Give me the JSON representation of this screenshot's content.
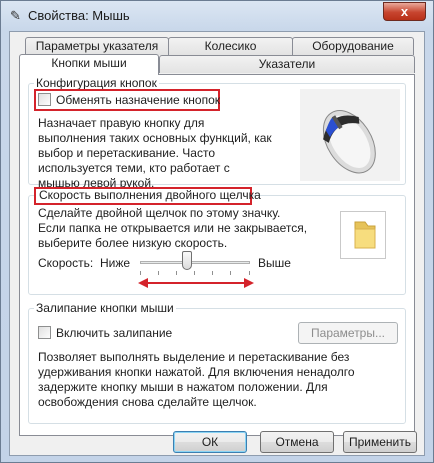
{
  "window": {
    "title": "Свойства: Мышь",
    "close": "x"
  },
  "tabs_back": [
    "Параметры указателя",
    "Колесико",
    "Оборудование"
  ],
  "tabs_front": [
    "Кнопки мыши",
    "Указатели"
  ],
  "buttons_config": {
    "title": "Конфигурация кнопок",
    "checkbox_label": "Обменять назначение кнопок",
    "checked": false,
    "description": "Назначает правую кнопку для выполнения таких основных функций, как выбор и перетаскивание. Часто используется теми, кто работает с мышью левой рукой."
  },
  "double_click": {
    "title": "Скорость выполнения двойного щелчка",
    "description": "Сделайте двойной щелчок по этому значку. Если папка не открывается или не закрывается, выберите более низкую скорость.",
    "speed_label": "Скорость:",
    "slow_label": "Ниже",
    "fast_label": "Выше",
    "slider_position": 0.42
  },
  "click_lock": {
    "title": "Залипание кнопки мыши",
    "checkbox_label": "Включить залипание",
    "checked": false,
    "settings_button": "Параметры...",
    "description": "Позволяет выполнять выделение и перетаскивание без удерживания кнопки нажатой. Для включения ненадолго задержите кнопку мыши в нажатом положении. Для освобождения снова сделайте щелчок."
  },
  "footer": {
    "ok": "ОК",
    "cancel": "Отмена",
    "apply": "Применить"
  },
  "colors": {
    "highlight": "#d4232b",
    "accent": "#3c7fb1"
  }
}
